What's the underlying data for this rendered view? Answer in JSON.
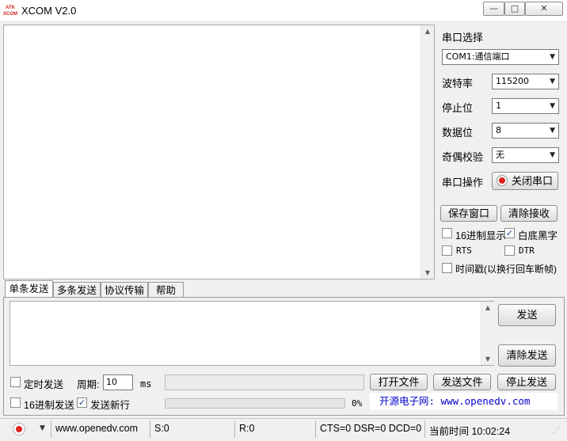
{
  "window": {
    "title": "XCOM V2.0",
    "logo_text_top": "ATK",
    "logo_text_bottom": "XCOM",
    "minimize": "—",
    "maximize": "□",
    "close": "✕"
  },
  "serial": {
    "port_label": "串口选择",
    "port_value": "COM1:通信端口",
    "baud_label": "波特率",
    "baud_value": "115200",
    "stop_label": "停止位",
    "stop_value": "1",
    "data_label": "数据位",
    "data_value": "8",
    "parity_label": "奇偶校验",
    "parity_value": "无",
    "op_label": "串口操作",
    "op_button": "关闭串口"
  },
  "buttons": {
    "save_window": "保存窗口",
    "clear_receive": "清除接收",
    "send": "发送",
    "clear_send": "清除发送",
    "open_file": "打开文件",
    "send_file": "发送文件",
    "stop_send": "停止发送"
  },
  "options": {
    "hex_display": "16进制显示",
    "white_black": "白底黑字",
    "rts": "RTS",
    "dtr": "DTR",
    "timestamp": "时间戳(以换行回车断帧)",
    "timed_send": "定时发送",
    "period_label": "周期:",
    "period_value": "10",
    "period_unit": "ms",
    "hex_send": "16进制发送",
    "send_newline": "发送新行",
    "progress_pct": "0%"
  },
  "tabs": [
    "单条发送",
    "多条发送",
    "协议传输",
    "帮助"
  ],
  "ad": "开源电子网: www.openedv.com",
  "status": {
    "url": "www.openedv.com",
    "sent": "S:0",
    "received": "R:0",
    "signals": "CTS=0 DSR=0 DCD=0",
    "time": "当前时间 10:02:24"
  },
  "colors": {
    "record_red": "#e02020",
    "link_blue": "#0000cc",
    "logo_red": "#d21f1f"
  }
}
